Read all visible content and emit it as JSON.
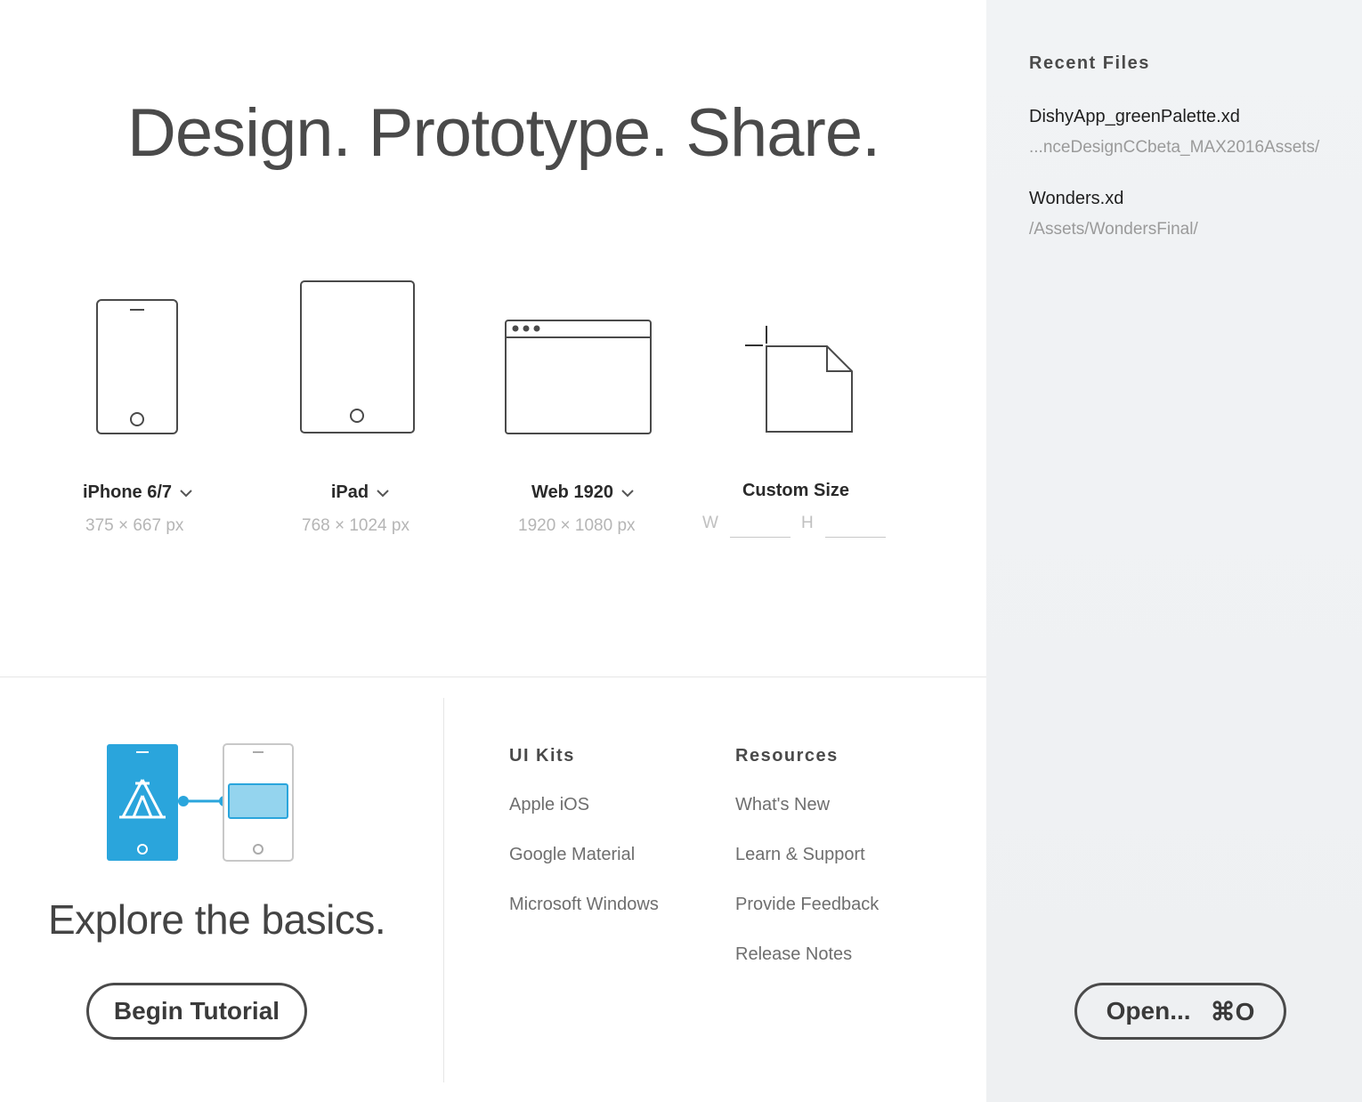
{
  "headline": "Design. Prototype. Share.",
  "presets": [
    {
      "name": "iPhone 6/7",
      "size": "375 × 667 px"
    },
    {
      "name": "iPad",
      "size": "768 × 1024 px"
    },
    {
      "name": "Web 1920",
      "size": "1920 × 1080 px"
    }
  ],
  "custom": {
    "name": "Custom Size",
    "width_label": "W",
    "height_label": "H",
    "width_value": "",
    "height_value": ""
  },
  "tutorial": {
    "heading": "Explore the basics.",
    "button_label": "Begin Tutorial"
  },
  "ui_kits": {
    "title": "UI Kits",
    "items": [
      "Apple iOS",
      "Google Material",
      "Microsoft Windows"
    ]
  },
  "resources": {
    "title": "Resources",
    "items": [
      "What's New",
      "Learn & Support",
      "Provide Feedback",
      "Release Notes"
    ]
  },
  "sidebar": {
    "title": "Recent Files",
    "files": [
      {
        "name": "DishyApp_greenPalette.xd",
        "path": "...nceDesignCCbeta_MAX2016Assets/"
      },
      {
        "name": "Wonders.xd",
        "path": "/Assets/WondersFinal/"
      }
    ],
    "open_label": "Open...",
    "open_shortcut": "⌘O"
  },
  "colors": {
    "accent": "#2aa5dc",
    "accent_light": "#94d4ee",
    "sidebar_bg": "#f0f2f4",
    "text_dark": "#2c2c2c",
    "text_muted": "#b5b5b5"
  },
  "icons": [
    "phone-icon",
    "tablet-icon",
    "browser-window-icon",
    "new-document-icon",
    "chevron-down-icon",
    "tutorial-illustration-icon"
  ]
}
